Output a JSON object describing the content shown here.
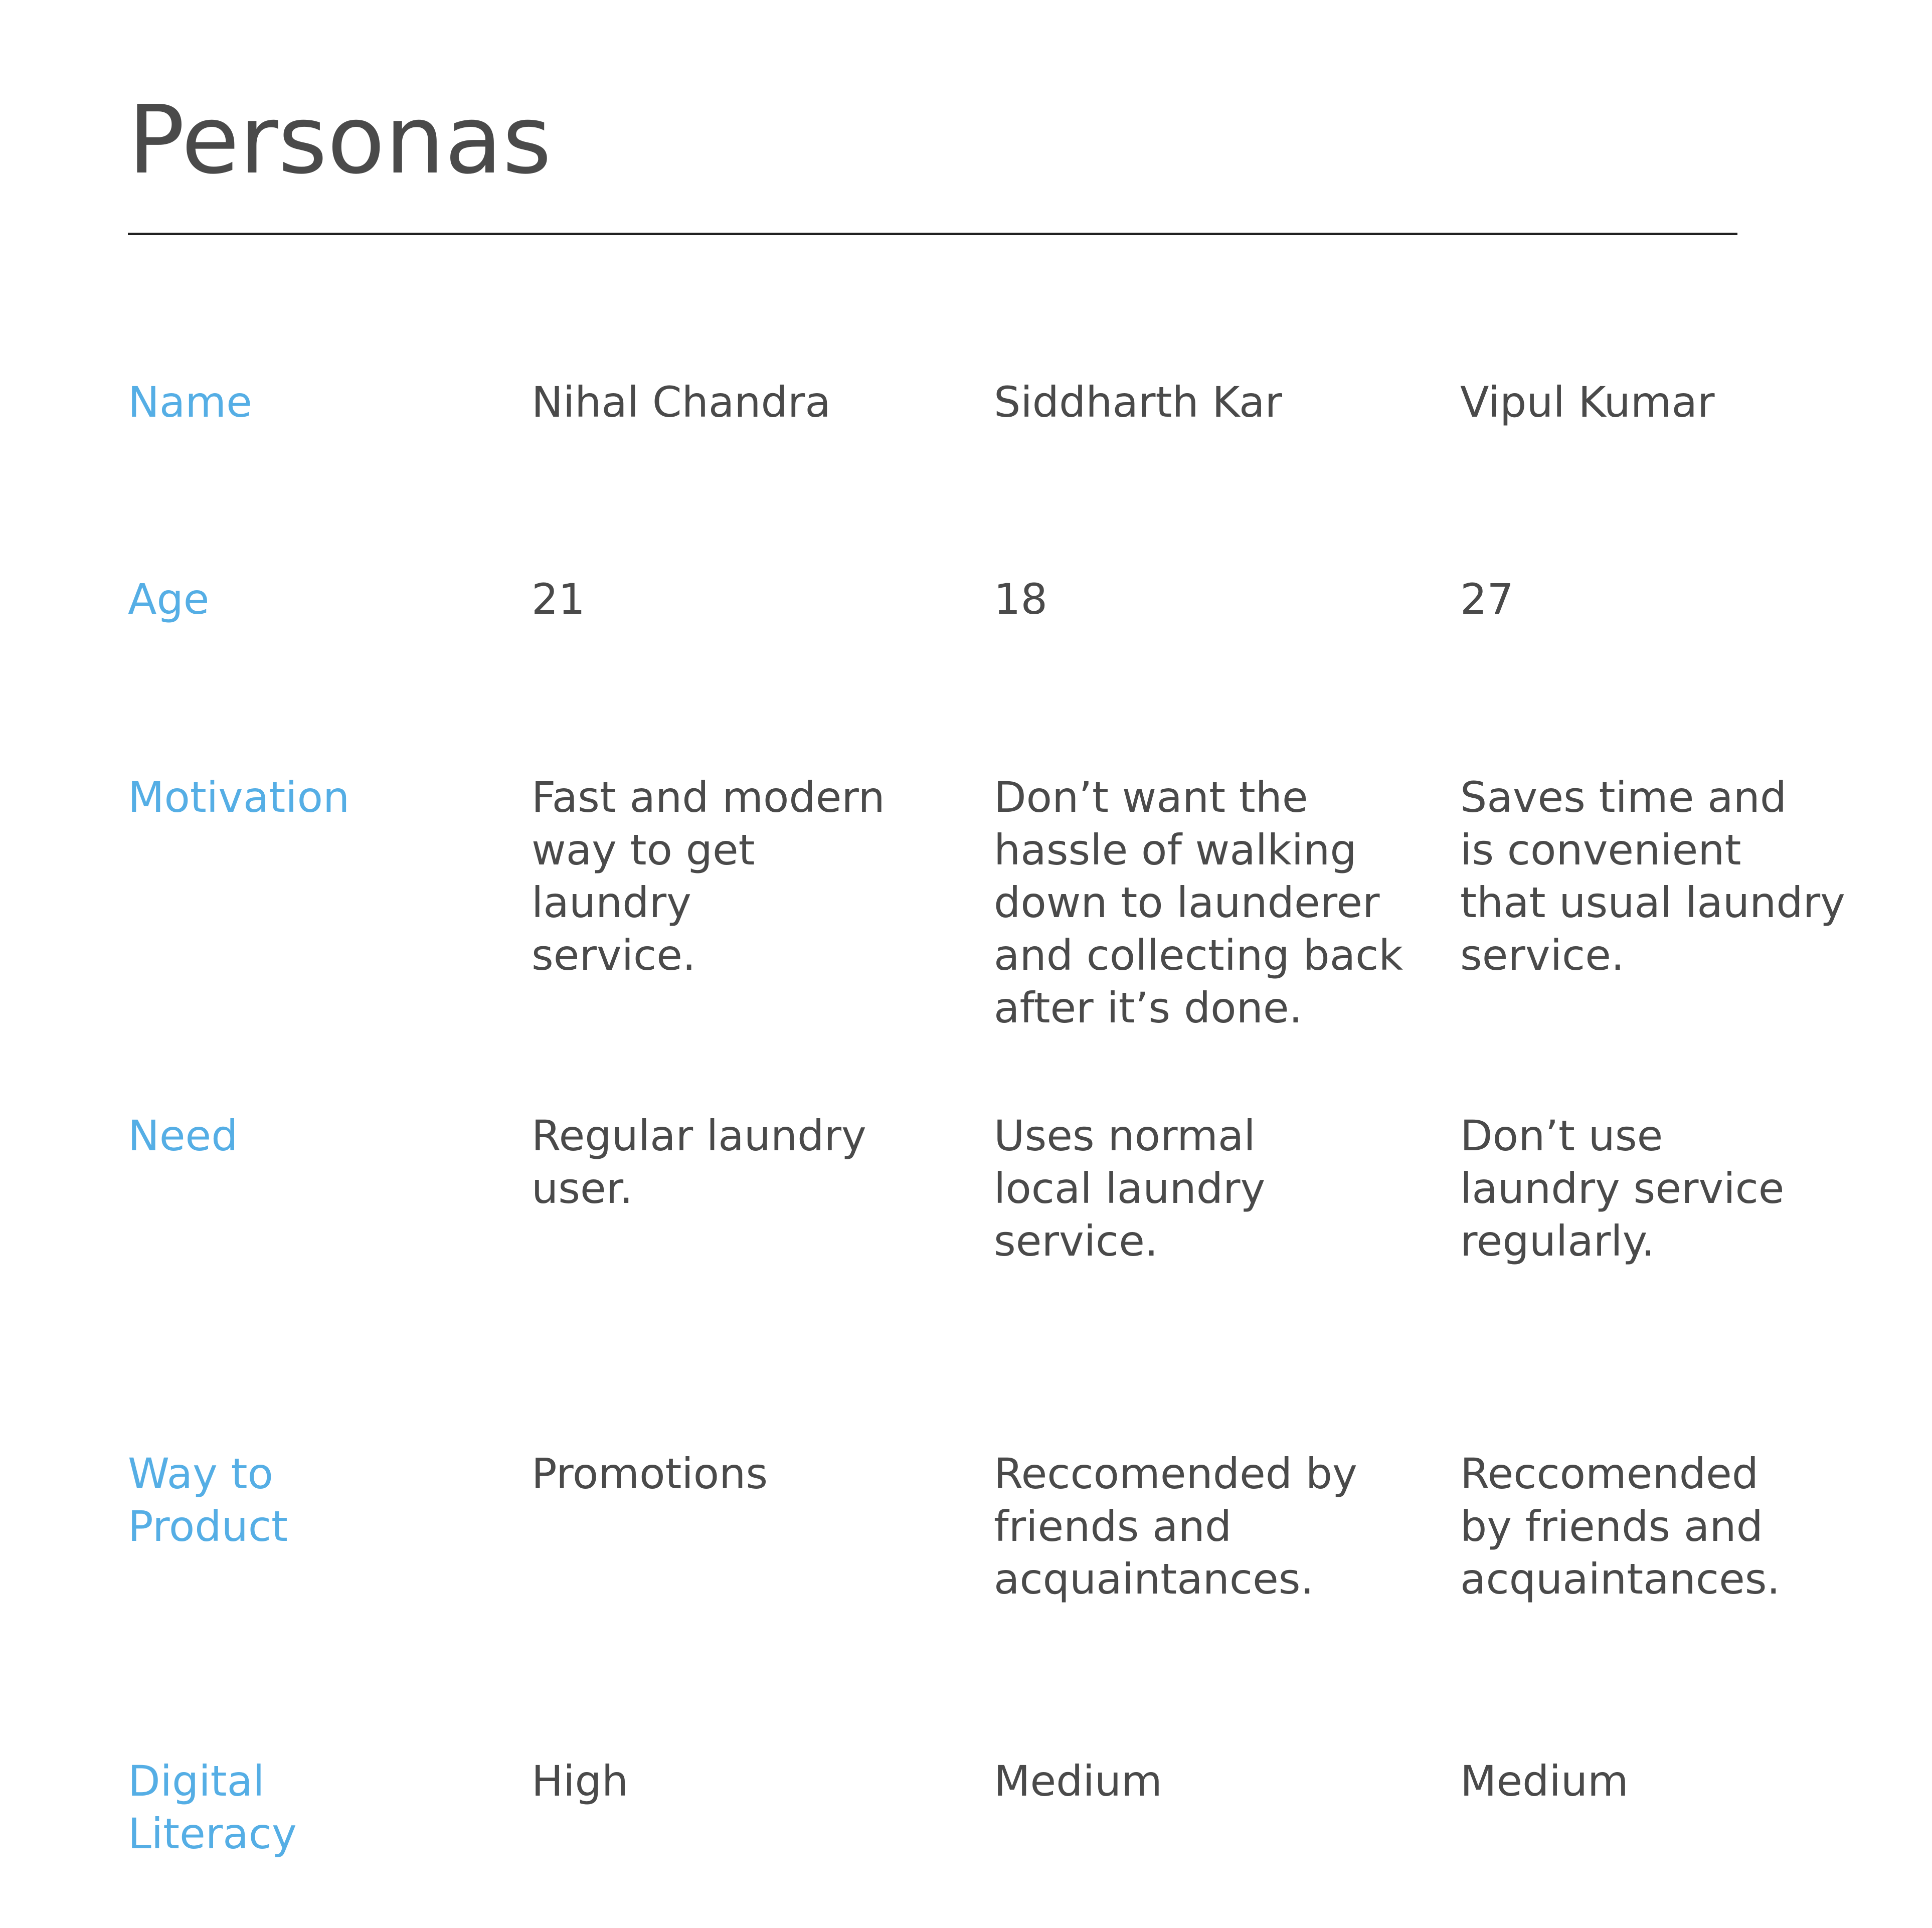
{
  "title": "Personas",
  "colors": {
    "label": "#55aee5",
    "text": "#4a4a4a",
    "rule": "#222222",
    "background": "#ffffff"
  },
  "labels": {
    "name": "Name",
    "age": "Age",
    "motivation": "Motivation",
    "need": "Need",
    "way_to_product": "Way to\nProduct",
    "digital_literacy": "Digital\nLiteracy"
  },
  "personas": [
    {
      "name": "Nihal Chandra",
      "age": "21",
      "motivation": "Fast and modern\nway to get laundry\nservice.",
      "need": "Regular laundry\nuser.",
      "way_to_product": "Promotions",
      "digital_literacy": "High"
    },
    {
      "name": "Siddharth Kar",
      "age": "18",
      "motivation": "Don’t want the\nhassle of walking\ndown to launderer\nand collecting back\nafter it’s done.",
      "need": "Uses normal\nlocal laundry\nservice.",
      "way_to_product": "Reccomended by\nfriends and\nacquaintances.",
      "digital_literacy": "Medium"
    },
    {
      "name": "Vipul Kumar",
      "age": "27",
      "motivation": "Saves time and\nis convenient\nthat usual laundry\nservice.",
      "need": "Don’t use\nlaundry service\nregularly.",
      "way_to_product": "Reccomended\nby friends and\nacquaintances.",
      "digital_literacy": "Medium"
    }
  ]
}
